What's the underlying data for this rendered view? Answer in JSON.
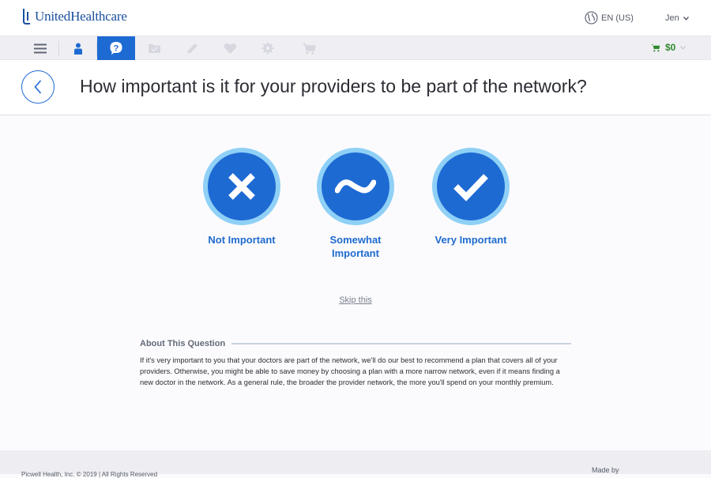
{
  "header": {
    "logo_text": "UnitedHealthcare",
    "language": "EN (US)",
    "user_name": "Jen"
  },
  "toolbar": {
    "items": [
      {
        "icon": "menu-icon",
        "active": false
      },
      {
        "icon": "person-icon",
        "active": false
      },
      {
        "icon": "question-icon",
        "active": true
      },
      {
        "icon": "folder-icon",
        "active": false
      },
      {
        "icon": "pencil-icon",
        "active": false
      },
      {
        "icon": "heart-icon",
        "active": false
      },
      {
        "icon": "gear-icon",
        "active": false
      },
      {
        "icon": "cart-icon",
        "active": false
      }
    ],
    "cart_amount": "$0"
  },
  "question": {
    "title": "How important is it for your providers to be part of the network?"
  },
  "options": [
    {
      "icon": "x-icon",
      "label_line1": "Not Important",
      "label_line2": ""
    },
    {
      "icon": "tilde-icon",
      "label_line1": "Somewhat",
      "label_line2": "Important"
    },
    {
      "icon": "checkmark-icon",
      "label_line1": "Very Important",
      "label_line2": ""
    }
  ],
  "skip_label": "Skip this",
  "about": {
    "heading": "About This Question",
    "body": "If it's very important to you that your doctors are part of the network, we'll do our best to recommend a plan that covers all of your providers. Otherwise, you might be able to save money by choosing a plan with a more narrow network, even if it means finding a new doctor in the network. As a general rule, the broader the provider network, the more you'll spend on your monthly premium."
  },
  "footer": {
    "copyright": "Picwell Health, Inc. © 2019  |  All Rights Reserved",
    "made_by": "Made by"
  },
  "colors": {
    "accent": "#1e6ad3",
    "ring": "#8fd0f6",
    "cart_green": "#2e8a2e"
  }
}
